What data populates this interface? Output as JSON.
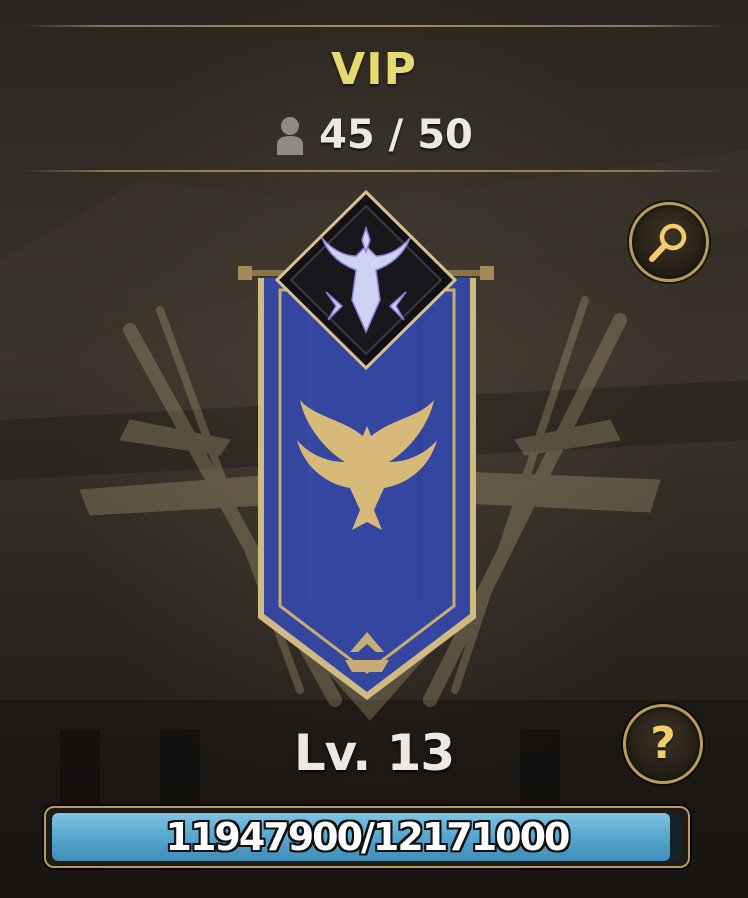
{
  "header": {
    "title": "VIP",
    "members_text": "45 / 50",
    "members_current": 45,
    "members_max": 50
  },
  "buttons": {
    "search_icon": "magnifier-icon",
    "help_label": "?"
  },
  "emblem": {
    "banner_icon": "phoenix-icon",
    "crest_icon": "horned-crest-icon",
    "background_icon": "crossed-swords-icon"
  },
  "guild": {
    "level_text": "Lv. 13"
  },
  "progress": {
    "text": "11947900/12171000",
    "current": 11947900,
    "max": 12171000
  },
  "colors": {
    "title_gold": "#e6d96f",
    "frame_gold": "#b89a5c",
    "banner_blue": "#3546a0",
    "bar_blue": "#5aa9d0"
  }
}
